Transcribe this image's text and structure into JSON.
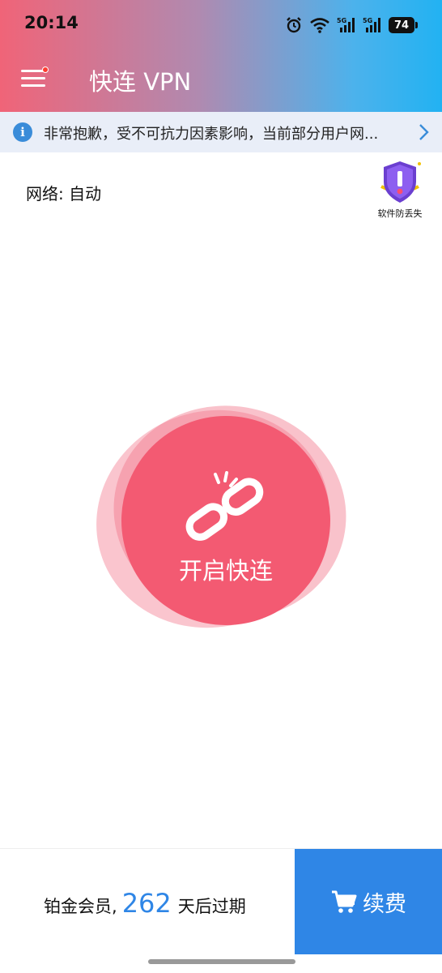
{
  "status_bar": {
    "time": "20:14",
    "signal1_label": "5G",
    "signal2_label": "5G",
    "battery": "74",
    "icons": [
      "alarm-icon",
      "wifi-icon",
      "signal-5g-icon",
      "signal-5g-icon",
      "battery-icon"
    ]
  },
  "app_bar": {
    "title": "快连 VPN",
    "menu_icon": "hamburger-menu-icon",
    "has_notification_dot": true,
    "gradient_colors": [
      "#f06478",
      "#22b2f2"
    ]
  },
  "notice": {
    "text": "非常抱歉，受不可抗力因素影响，当前部分用户网...",
    "icon": "info-icon",
    "arrow_icon": "chevron-right-icon"
  },
  "network": {
    "label": "网络: 自动"
  },
  "anti_lost": {
    "label": "软件防丢失",
    "icon": "shield-alert-icon"
  },
  "connect": {
    "label": "开启快连",
    "icon": "broken-link-icon",
    "color": "#f35a72"
  },
  "membership": {
    "prefix": "铂金会员,",
    "days": "262",
    "suffix": "天后过期"
  },
  "renew": {
    "label": "续费",
    "icon": "cart-icon",
    "color": "#2f86e6"
  }
}
